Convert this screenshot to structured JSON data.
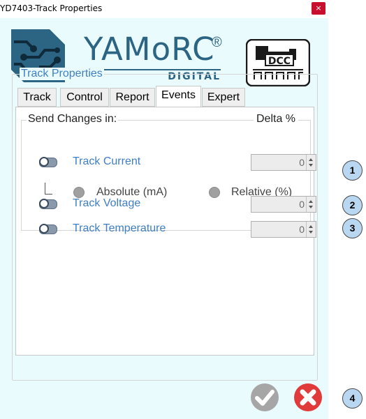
{
  "window": {
    "title": "YD7403-Track Properties",
    "close_glyph": "×"
  },
  "logo": {
    "brand": "YAMoRC",
    "registered": "®",
    "sub": "DIGITAL",
    "dcc_text": "DCC"
  },
  "group": {
    "title": "Track Properties",
    "tabs": [
      {
        "label": "Track"
      },
      {
        "label": "Control"
      },
      {
        "label": "Report"
      },
      {
        "label": "Events",
        "active": true
      },
      {
        "label": "Expert"
      }
    ]
  },
  "events": {
    "send_title": "Send Changes in:",
    "delta_title": "Delta %",
    "rows": [
      {
        "label": "Track Current",
        "value": "0"
      },
      {
        "label": "Track Voltage",
        "value": "0"
      },
      {
        "label": "Track Temperature",
        "value": "0"
      }
    ],
    "mode": {
      "absolute": "Absolute (mA)",
      "relative": "Relative (%)"
    }
  },
  "badges": [
    "1",
    "2",
    "3",
    "4"
  ],
  "colors": {
    "accent": "#3f7fc2",
    "brand": "#2c6583",
    "panel": "#eafbfd",
    "cancel": "#e03a3a",
    "ok": "#a6a6a6"
  },
  "icons": {
    "ok": "check-circle-icon",
    "cancel": "x-circle-icon",
    "toggle": "toggle-off-icon"
  }
}
